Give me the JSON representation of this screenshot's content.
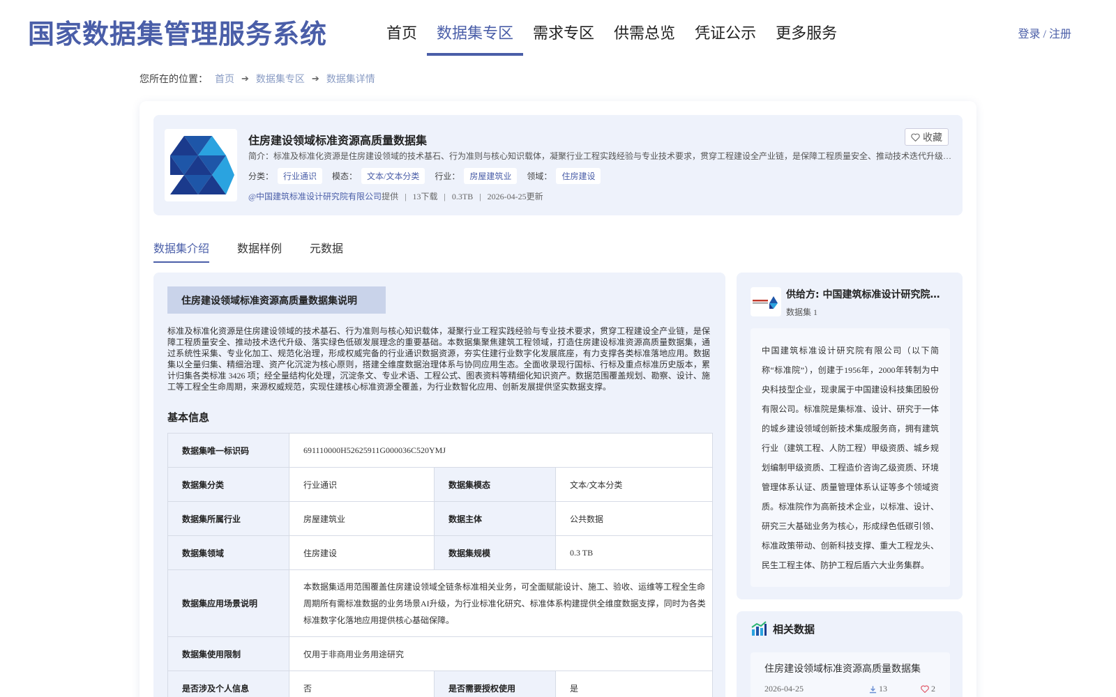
{
  "header": {
    "site_title": "国家数据集管理服务系统",
    "nav": [
      {
        "label": "首页",
        "active": false
      },
      {
        "label": "数据集专区",
        "active": true
      },
      {
        "label": "需求专区",
        "active": false
      },
      {
        "label": "供需总览",
        "active": false
      },
      {
        "label": "凭证公示",
        "active": false
      },
      {
        "label": "更多服务",
        "active": false
      }
    ],
    "login_label": "登录",
    "login_sep": " / ",
    "register_label": "注册"
  },
  "breadcrumb": {
    "prefix": "您所在的位置：",
    "items": [
      "首页",
      "数据集专区",
      "数据集详情"
    ],
    "arrow": "➔"
  },
  "dataset": {
    "title": "住房建设领域标准资源高质量数据集",
    "summary": "简介：标准及标准化资源是住房建设领域的技术基石、行为准则与核心知识载体，凝聚行业工程实践经验与专业技术要求，贯穿工程建设全产业链，是保障工程质量安全、推动技术迭代升级、落实绿色低碳发展理念的重要基础。本数据集聚焦建筑工程领域，打造住房建设标准资源高质量数据集",
    "favorite_label": "收藏",
    "tag_labels": {
      "category": "分类：",
      "modality": "模态：",
      "industry": "行业：",
      "domain": "领域："
    },
    "tags": {
      "category": "行业通识",
      "modality": "文本/文本分类",
      "industry": "房屋建筑业",
      "domain": "住房建设"
    },
    "provider": "@中国建筑标准设计研究院有限公司",
    "provided_suffix": "提供",
    "downloads": "13下载",
    "size": "0.3TB",
    "updated": "2026-04-25更新",
    "meta_sep": "|"
  },
  "tabs": [
    {
      "label": "数据集介绍",
      "active": true
    },
    {
      "label": "数据样例",
      "active": false
    },
    {
      "label": "元数据",
      "active": false
    }
  ],
  "intro": {
    "section_title": "住房建设领域标准资源高质量数据集说明",
    "text": "标准及标准化资源是住房建设领域的技术基石、行为准则与核心知识载体，凝聚行业工程实践经验与专业技术要求，贯穿工程建设全产业链，是保障工程质量安全、推动技术迭代升级、落实绿色低碳发展理念的重要基础。本数据集聚焦建筑工程领域，打造住房建设标准资源高质量数据集，通过系统性采集、专业化加工、规范化治理，形成权威完备的行业通识数据资源，夯实住建行业数字化发展底座，有力支撑各类标准落地应用。数据集以全量归集、精细治理、资产化沉淀为核心原则，搭建全维度数据治理体系与协同应用生态。全面收录现行国标、行标及重点标准历史版本，累计归集各类标准 3426 项；经全量结构化处理，沉淀条文、专业术语、工程公式、图表资料等精细化知识资产。数据范围覆盖规划、勘察、设计、施工等工程全生命周期，来源权威规范，实现住建核心标准资源全覆盖，为行业数智化应用、创新发展提供坚实数据支撑。"
  },
  "basic_info": {
    "title": "基本信息",
    "rows": {
      "uid_k": "数据集唯一标识码",
      "uid_v": "691110000H52625911G000036C520YMJ",
      "category_k": "数据集分类",
      "category_v": "行业通识",
      "modality_k": "数据集模态",
      "modality_v": "文本/文本分类",
      "industry_k": "数据集所属行业",
      "industry_v": "房屋建筑业",
      "subject_k": "数据主体",
      "subject_v": "公共数据",
      "domain_k": "数据集领域",
      "domain_v": "住房建设",
      "scale_k": "数据集规模",
      "scale_v": "0.3 TB",
      "scenario_k": "数据集应用场景说明",
      "scenario_v": "本数据集适用范围覆盖住房建设领域全链条标准相关业务，可全面赋能设计、施工、验收、运维等工程全生命周期所有需标准数据的业务场景AI升级，为行业标准化研究、标准体系构建提供全维度数据支撑，同时为各类标准数字化落地应用提供核心基础保障。",
      "restrict_k": "数据集使用限制",
      "restrict_v": "仅用于非商用业务用途研究",
      "personal_k": "是否涉及个人信息",
      "personal_v": "否",
      "auth_k": "是否需要授权使用",
      "auth_v": "是"
    }
  },
  "provider_card": {
    "name": "供给方: 中国建筑标准设计研究院有限公司",
    "count": "数据集 1",
    "description": "中国建筑标准设计研究院有限公司（以下简称“标准院”），创建于1956年，2000年转制为中央科技型企业，现隶属于中国建设科技集团股份有限公司。标准院是集标准、设计、研究于一体的城乡建设领域创新技术集成服务商，拥有建筑行业（建筑工程、人防工程）甲级资质、城乡规划编制甲级资质、工程造价咨询乙级资质、环境管理体系认证、质量管理体系认证等多个领域资质。标准院作为高新技术企业，以标准、设计、研究三大基础业务为核心，形成绿色低碳引领、标准政策带动、创新科技支撑、重大工程龙头、民生工程主体、防护工程后盾六大业务集群。"
  },
  "related": {
    "title": "相关数据",
    "items": [
      {
        "title": "住房建设领域标准资源高质量数据集",
        "date": "2026-04-25",
        "downloads": "13",
        "likes": "2"
      }
    ]
  },
  "colors": {
    "brand": "#4a5ea8",
    "panel_bg": "#eef2fb",
    "logo_dark": "#1b3a8c",
    "logo_light": "#2aa3e0"
  },
  "icons": {
    "favorite": "heart-icon",
    "arrow": "arrow-right-icon",
    "download": "download-icon",
    "like": "heart-icon",
    "related": "bar-chart-icon"
  }
}
